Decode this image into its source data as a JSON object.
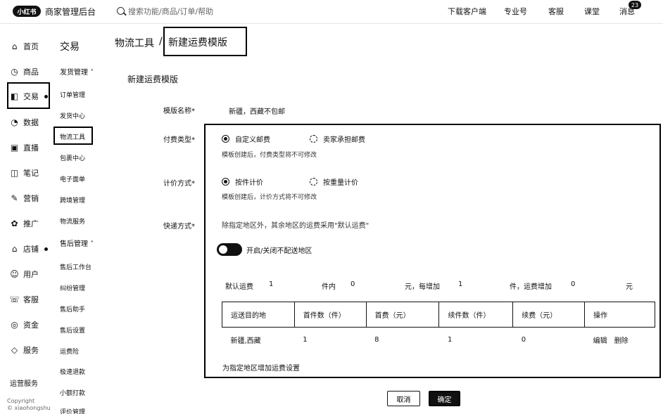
{
  "topbar": {
    "logo_text": "小红书",
    "app_title": "商家管理后台",
    "search_placeholder": "搜索功能/商品/订单/帮助",
    "links": [
      "下载客户端",
      "专业号",
      "客服",
      "课堂",
      "消息"
    ],
    "message_badge": "23"
  },
  "primary_nav": [
    {
      "label": "首页",
      "icon": "home-icon",
      "glyph": "⌂"
    },
    {
      "label": "商品",
      "icon": "bag-icon",
      "glyph": "◷"
    },
    {
      "label": "交易",
      "icon": "trade-icon",
      "glyph": "◧"
    },
    {
      "label": "数据",
      "icon": "chart-icon",
      "glyph": "◔"
    },
    {
      "label": "直播",
      "icon": "live-icon",
      "glyph": "▣"
    },
    {
      "label": "笔记",
      "icon": "book-icon",
      "glyph": "◫"
    },
    {
      "label": "营销",
      "icon": "marketing-icon",
      "glyph": "✎"
    },
    {
      "label": "推广",
      "icon": "promotion-icon",
      "glyph": "✿"
    },
    {
      "label": "店铺",
      "icon": "shop-icon",
      "glyph": "⌂"
    },
    {
      "label": "用户",
      "icon": "user-icon",
      "glyph": "☺"
    },
    {
      "label": "客服",
      "icon": "service-icon",
      "glyph": "☏"
    },
    {
      "label": "资金",
      "icon": "money-icon",
      "glyph": "◎"
    },
    {
      "label": "服务",
      "icon": "diamond-icon",
      "glyph": "◇"
    }
  ],
  "footer": {
    "link": "运营服务",
    "copyright_1": "Copyright",
    "copyright_2": "© xiaohongshu"
  },
  "secondary_nav": {
    "title": "交易",
    "group_shipping": "发货管理",
    "shipping_items": [
      "订单管理",
      "发货中心",
      "物流工具",
      "包裹中心",
      "电子面单",
      "跨境管理",
      "物流服务"
    ],
    "group_aftersale": "售后管理",
    "aftersale_items": [
      "售后工作台",
      "纠纷管理",
      "售后助手",
      "售后设置",
      "运费险",
      "极速退款",
      "小额打款",
      "评价管理"
    ]
  },
  "breadcrumb": {
    "parent": "物流工具",
    "separator": "/",
    "current": "新建运费模版"
  },
  "form": {
    "section_title": "新建运费模版",
    "name_label": "模版名称*",
    "name_value": "新疆，西藏不包邮",
    "pay_type_label": "付费类型*",
    "pay_type_options": [
      "自定义邮费",
      "卖家承担邮费"
    ],
    "pay_type_hint": "模板创建后，付费类型将不可修改",
    "pricing_label": "计价方式*",
    "pricing_options": [
      "按件计价",
      "按重量计价"
    ],
    "pricing_hint": "模板创建后，计价方式将不可修改",
    "delivery_label": "快递方式*",
    "delivery_hint": "除指定地区外，其余地区的运费采用\"默认运费\"",
    "toggle_label": "开启/关闭不配送地区",
    "default_fee": {
      "prefix": "默认运费",
      "first_qty": "1",
      "unit1": "件内",
      "first_fee": "0",
      "unit2": "元，每增加",
      "extra_qty": "1",
      "unit3": "件，运费增加",
      "extra_fee": "0",
      "unit4": "元"
    },
    "table": {
      "headers": [
        "运送目的地",
        "首件数（件）",
        "首费（元）",
        "续件数（件）",
        "续费（元）",
        "操作"
      ],
      "rows": [
        {
          "region": "新疆,西藏",
          "first_qty": "1",
          "first_fee": "8",
          "extra_qty": "1",
          "extra_fee": "0",
          "edit": "编辑",
          "delete": "删除"
        }
      ]
    },
    "add_region": "为指定地区增加运费设置"
  },
  "actions": {
    "cancel": "取消",
    "confirm": "确定"
  }
}
